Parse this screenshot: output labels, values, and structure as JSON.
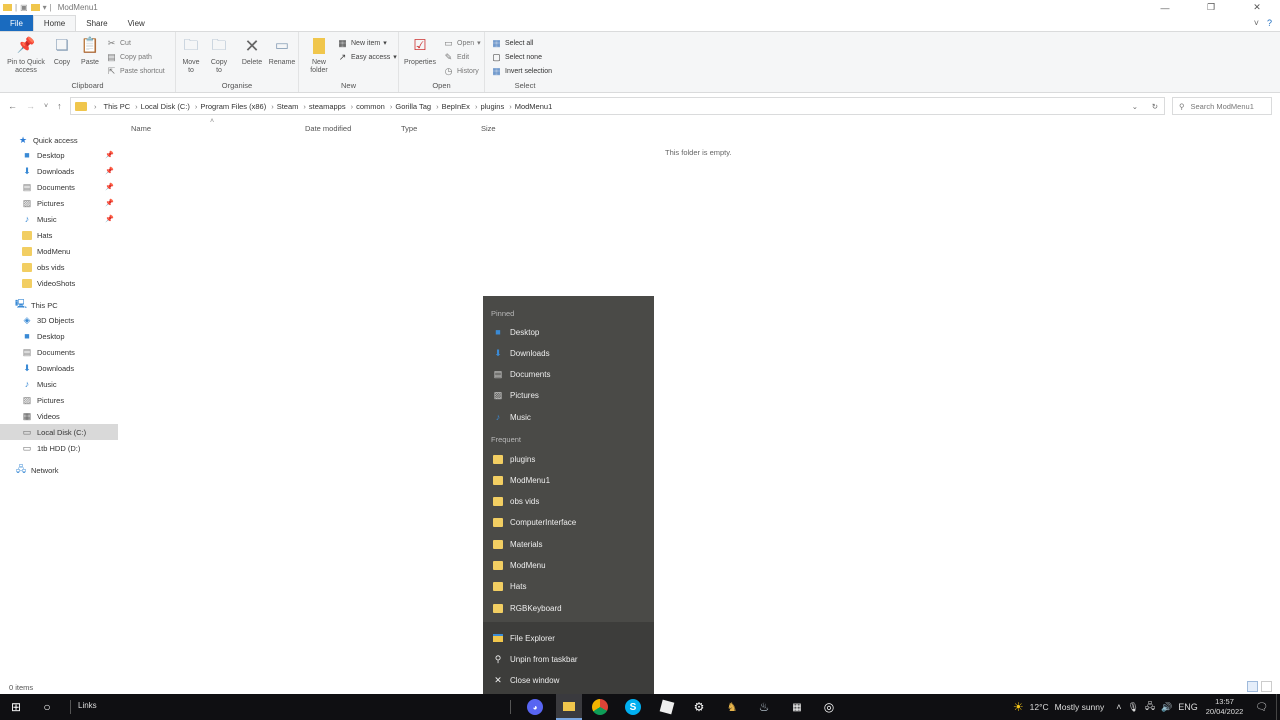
{
  "window": {
    "title": "ModMenu1",
    "tabs": [
      "File",
      "Home",
      "Share",
      "View"
    ]
  },
  "ribbon": {
    "clipboard": {
      "label": "Clipboard",
      "pin": "Pin to Quick access",
      "copy": "Copy",
      "paste": "Paste",
      "cut": "Cut",
      "copy_path": "Copy path",
      "paste_shortcut": "Paste shortcut"
    },
    "organise": {
      "label": "Organise",
      "move_to": "Move to",
      "copy_to": "Copy to",
      "delete": "Delete",
      "rename": "Rename"
    },
    "new": {
      "label": "New",
      "new_folder": "New folder",
      "new_item": "New item",
      "easy_access": "Easy access"
    },
    "open": {
      "label": "Open",
      "properties": "Properties",
      "open": "Open",
      "edit": "Edit",
      "history": "History"
    },
    "select": {
      "label": "Select",
      "select_all": "Select all",
      "select_none": "Select none",
      "invert": "Invert selection"
    }
  },
  "address": {
    "crumbs": [
      "This PC",
      "Local Disk (C:)",
      "Program Files (x86)",
      "Steam",
      "steamapps",
      "common",
      "Gorilla Tag",
      "BepInEx",
      "plugins",
      "ModMenu1"
    ],
    "search_placeholder": "Search ModMenu1"
  },
  "nav": {
    "quick_access": "Quick access",
    "quick_items": [
      "Desktop",
      "Downloads",
      "Documents",
      "Pictures",
      "Music",
      "Hats",
      "ModMenu",
      "obs vids",
      "VideoShots"
    ],
    "this_pc": "This PC",
    "pc_items": [
      "3D Objects",
      "Desktop",
      "Documents",
      "Downloads",
      "Music",
      "Pictures",
      "Videos",
      "Local Disk (C:)",
      "1tb HDD (D:)"
    ],
    "network": "Network"
  },
  "content": {
    "columns": [
      "Name",
      "Date modified",
      "Type",
      "Size"
    ],
    "empty_text": "This folder is empty."
  },
  "status": {
    "items": "0 items"
  },
  "jumplist": {
    "pinned_label": "Pinned",
    "pinned": [
      "Desktop",
      "Downloads",
      "Documents",
      "Pictures",
      "Music"
    ],
    "frequent_label": "Frequent",
    "frequent": [
      "plugins",
      "ModMenu1",
      "obs vids",
      "ComputerInterface",
      "Materials",
      "ModMenu",
      "Hats",
      "RGBKeyboard"
    ],
    "actions": [
      "File Explorer",
      "Unpin from taskbar",
      "Close window"
    ]
  },
  "taskbar": {
    "links": "Links",
    "weather_temp": "12°C",
    "weather_desc": "Mostly sunny",
    "time": "13:57",
    "date": "20/04/2022"
  }
}
